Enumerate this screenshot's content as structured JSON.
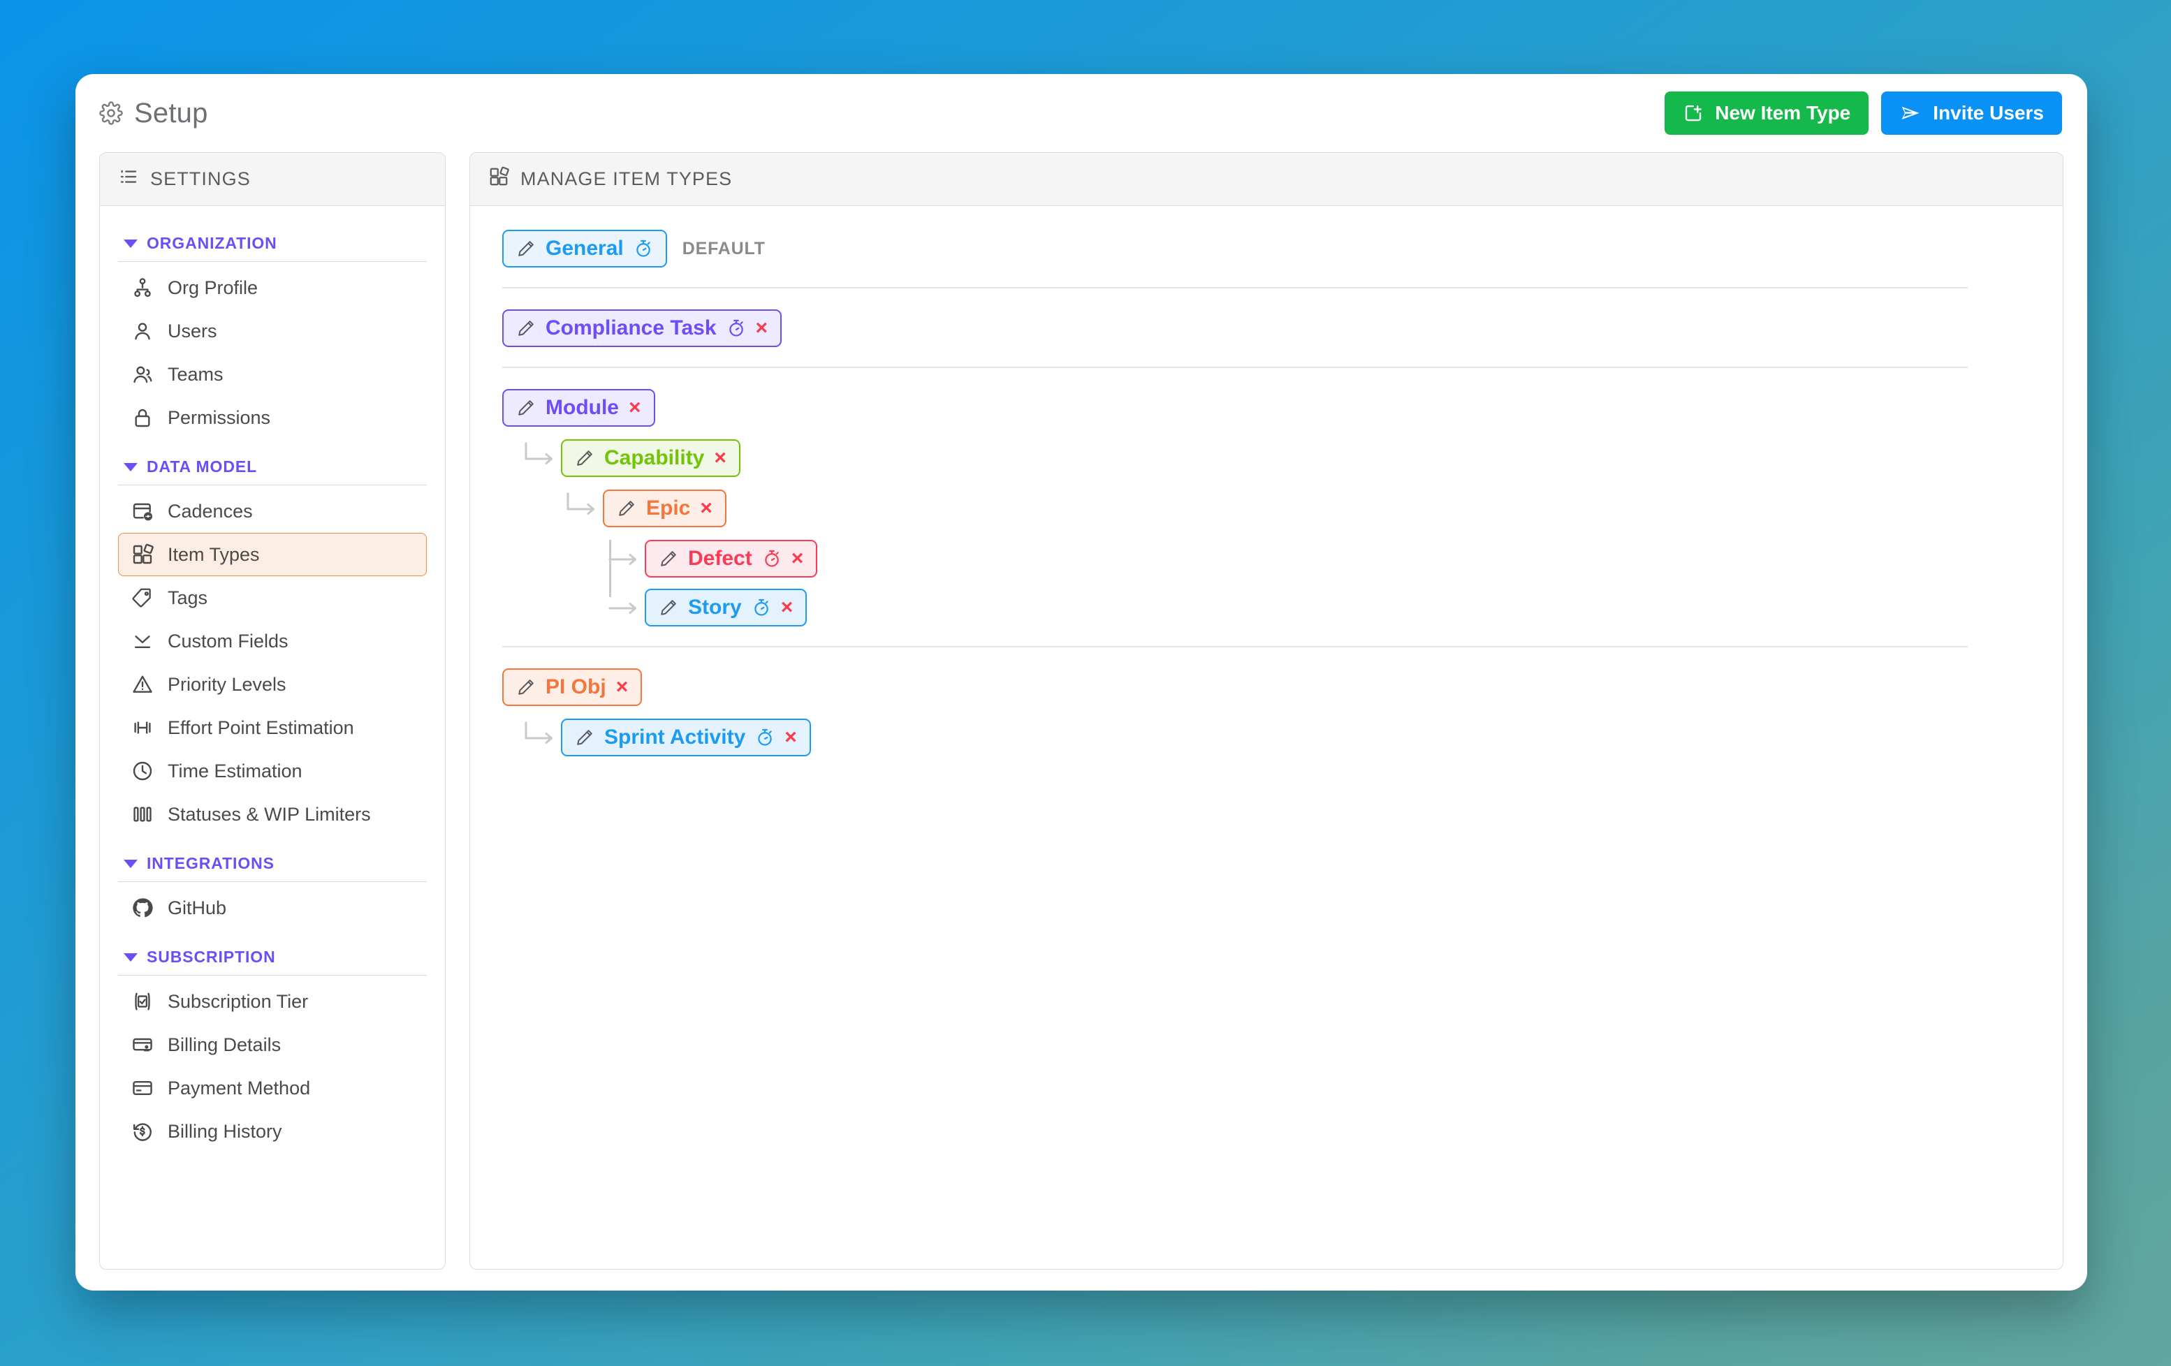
{
  "header": {
    "title": "Setup",
    "gear_icon": "gear-icon",
    "buttons": [
      {
        "label": "New Item Type",
        "icon": "add-square-icon",
        "color": "#14b84b"
      },
      {
        "label": "Invite Users",
        "icon": "paper-plane-icon",
        "color": "#0a91f5"
      }
    ]
  },
  "sidebar": {
    "panel_title": "SETTINGS",
    "panel_icon": "list-icon",
    "groups": [
      {
        "label": "ORGANIZATION",
        "items": [
          {
            "label": "Org Profile",
            "icon": "org-chart-icon",
            "selected": false
          },
          {
            "label": "Users",
            "icon": "user-icon",
            "selected": false
          },
          {
            "label": "Teams",
            "icon": "users-group-icon",
            "selected": false
          },
          {
            "label": "Permissions",
            "icon": "lock-icon",
            "selected": false
          }
        ]
      },
      {
        "label": "DATA MODEL",
        "items": [
          {
            "label": "Cadences",
            "icon": "calendar-sync-icon",
            "selected": false
          },
          {
            "label": "Item Types",
            "icon": "item-types-icon",
            "selected": true
          },
          {
            "label": "Tags",
            "icon": "tag-icon",
            "selected": false
          },
          {
            "label": "Custom Fields",
            "icon": "collapse-icon",
            "selected": false
          },
          {
            "label": "Priority Levels",
            "icon": "warning-triangle-icon",
            "selected": false
          },
          {
            "label": "Effort Point Estimation",
            "icon": "dumbbell-icon",
            "selected": false
          },
          {
            "label": "Time Estimation",
            "icon": "clock-icon",
            "selected": false
          },
          {
            "label": "Statuses & WIP Limiters",
            "icon": "columns-icon",
            "selected": false
          }
        ]
      },
      {
        "label": "INTEGRATIONS",
        "items": [
          {
            "label": "GitHub",
            "icon": "github-icon",
            "selected": false
          }
        ]
      },
      {
        "label": "SUBSCRIPTION",
        "items": [
          {
            "label": "Subscription Tier",
            "icon": "checkbox-icon",
            "selected": false
          },
          {
            "label": "Billing Details",
            "icon": "billing-card-icon",
            "selected": false
          },
          {
            "label": "Payment Method",
            "icon": "credit-card-icon",
            "selected": false
          },
          {
            "label": "Billing History",
            "icon": "history-dollar-icon",
            "selected": false
          }
        ]
      }
    ]
  },
  "main": {
    "panel_title": "MANAGE ITEM TYPES",
    "panel_icon": "item-types-icon",
    "default_tag": "DEFAULT",
    "groups": [
      {
        "root": {
          "label": "General",
          "color": "#1c9bf0",
          "bg": "#e9f4fd",
          "timer": true,
          "removable": false,
          "is_default": true
        },
        "children": []
      },
      {
        "root": {
          "label": "Compliance Task",
          "color": "#6d4df6",
          "bg": "#eeeaff",
          "timer": true,
          "removable": true,
          "is_default": false
        },
        "children": []
      },
      {
        "root": {
          "label": "Module",
          "color": "#6d4df6",
          "bg": "#eeeaff",
          "timer": false,
          "removable": true,
          "is_default": false
        },
        "children": [
          {
            "label": "Capability",
            "color": "#71c408",
            "bg": "#f1f9e6",
            "timer": false,
            "removable": true,
            "children": [
              {
                "label": "Epic",
                "color": "#f4763b",
                "bg": "#fdeee7",
                "timer": false,
                "removable": true,
                "siblings": [
                  {
                    "label": "Defect",
                    "color": "#fb3b56",
                    "bg": "#fdeaee",
                    "timer": true,
                    "removable": true
                  },
                  {
                    "label": "Story",
                    "color": "#1c9bf0",
                    "bg": "#e4f2fd",
                    "timer": true,
                    "removable": true
                  }
                ]
              }
            ]
          }
        ]
      },
      {
        "root": {
          "label": "PI Obj",
          "color": "#f4763b",
          "bg": "#fdeee7",
          "timer": false,
          "removable": true,
          "is_default": false
        },
        "children": [
          {
            "label": "Sprint Activity",
            "color": "#1c9bf0",
            "bg": "#e4f2fd",
            "timer": true,
            "removable": true,
            "children": []
          }
        ]
      }
    ],
    "remove_label": "×"
  }
}
